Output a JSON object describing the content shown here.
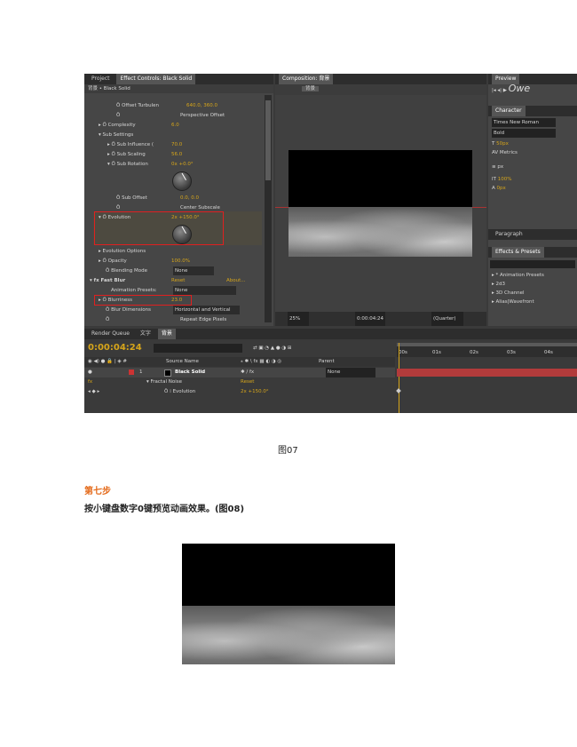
{
  "screenshot": {
    "project_tab": "Project",
    "effect_tab": "Effect Controls: Black Solid",
    "effect_sub": "背景 • Black Solid",
    "effect_rows": [
      {
        "label": "Ö Offset Turbulen",
        "value": "640.0, 360.0"
      },
      {
        "label": "Ö",
        "value": "Perspective Offset"
      },
      {
        "label": "▸ Ö Complexity",
        "value": "6.0"
      },
      {
        "label": "▾ Sub Settings",
        "value": ""
      },
      {
        "label": "▸ Ö Sub Influence (",
        "value": "70.0"
      },
      {
        "label": "▸ Ö Sub Scaling",
        "value": "56.0"
      },
      {
        "label": "▾ Ö Sub Rotation",
        "value": "0x +0.0°"
      }
    ],
    "sub_offset_label": "Ö Sub Offset",
    "sub_offset_value": "0.0, 0.0",
    "center_subscale": "Center Subscale",
    "evolution_label": "▾ Ö Evolution",
    "evolution_value": "2x +150.0°",
    "lower_rows": [
      {
        "label": "▸ Evolution Options",
        "value": ""
      },
      {
        "label": "▸ Ö Opacity",
        "value": "100.0%"
      },
      {
        "label": "Ö Blending Mode",
        "value": "None"
      }
    ],
    "fast_blur_label": "▾ fx Fast Blur",
    "fast_blur_reset": "Reset",
    "fast_blur_about": "About...",
    "anim_presets_label": "Animation Presets:",
    "anim_presets_value": "None",
    "blurriness_label": "▸ Ö Blurriness",
    "blurriness_value": "23.0",
    "blur_dim_label": "Ö Blur Dimensions",
    "blur_dim_value": "Horizontal and Vertical",
    "repeat_edge": "Repeat Edge Pixels",
    "comp_tab": "Composition: 背景",
    "comp_sub": "背景",
    "comp_zoom": "25%",
    "comp_time": "0:00:04:24",
    "comp_quality": "(Quarter)",
    "preview_tab": "Preview",
    "character_tab": "Character",
    "font_name": "Times New Roman",
    "font_style": "Bold",
    "font_size": "50px",
    "metrics": "Metrics",
    "px_label": "px",
    "scale_pct": "100%",
    "baseline": "0px",
    "paragraph_tab": "Paragraph",
    "effects_tab": "Effects & Presets",
    "effects_items": [
      "▸ * Animation Presets",
      "▸ 2d3",
      "▸ 3D Channel",
      "▸ Alias|Wavefront"
    ],
    "render_tabs": [
      "Render Queue",
      "文字",
      "背景"
    ],
    "timecode": "0:00:04:24",
    "tl_header_source": "Source Name",
    "tl_header_parent": "Parent",
    "layer_num": "1",
    "layer_name": "Black Solid",
    "layer_parent": "None",
    "fractal_label": "▾ Fractal Noise",
    "fractal_reset": "Reset",
    "evo_row_label": "Ö ⁞ Evolution",
    "evo_row_value": "2x +150.0°",
    "ruler": [
      "00s",
      "01s",
      "02s",
      "03s",
      "04s"
    ]
  },
  "fig07_caption": "图07",
  "step_title": "第七步",
  "step_text": "按小键盘数字0键预览动画效果。(图08)"
}
